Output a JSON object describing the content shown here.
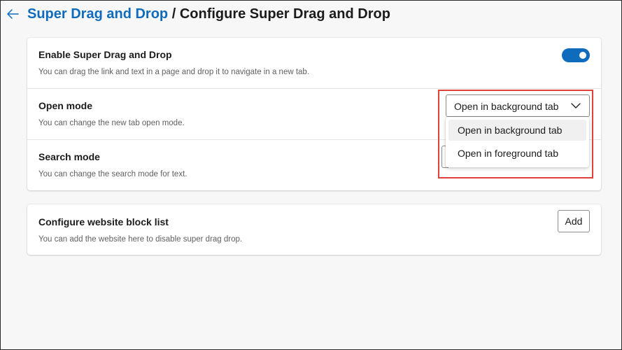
{
  "header": {
    "back_icon": "arrow-left-icon",
    "breadcrumb_parent": "Super Drag and Drop",
    "separator": " / ",
    "breadcrumb_current": "Configure Super Drag and Drop"
  },
  "settings": {
    "enable": {
      "title": "Enable Super Drag and Drop",
      "description": "You can drag the link and text in a page and drop it to navigate in a new tab.",
      "toggle_on": true
    },
    "open_mode": {
      "title": "Open mode",
      "description": "You can change the new tab open mode.",
      "selected": "Open in background tab",
      "options": [
        "Open in background tab",
        "Open in foreground tab"
      ]
    },
    "search_mode": {
      "title": "Search mode",
      "description": "You can change the search mode for text."
    }
  },
  "block_list": {
    "title": "Configure website block list",
    "description": "You can add the website here to disable super drag drop.",
    "add_label": "Add"
  },
  "colors": {
    "accent": "#0f6cbd",
    "highlight": "#e0413a",
    "background": "#f7f7f7"
  }
}
